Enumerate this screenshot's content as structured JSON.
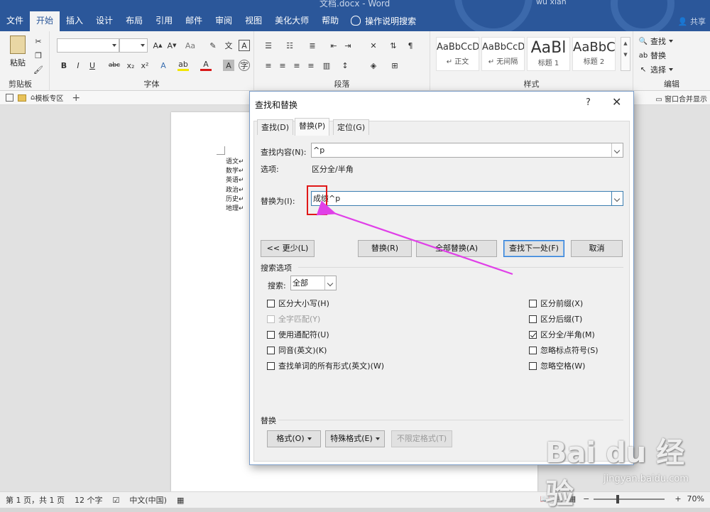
{
  "window": {
    "title": "文档.docx  -  Word",
    "user": "wu xian",
    "share": "共享"
  },
  "menu": {
    "items": [
      "文件",
      "开始",
      "插入",
      "设计",
      "布局",
      "引用",
      "邮件",
      "审阅",
      "视图",
      "美化大师",
      "帮助"
    ],
    "active_index": 1,
    "tell_me": "操作说明搜索"
  },
  "ribbon": {
    "clipboard": {
      "paste": "粘贴",
      "label": "剪贴板"
    },
    "font": {
      "label": "字体",
      "bold": "B",
      "italic": "I",
      "underline": "U",
      "strike": "abc",
      "sub": "x₂",
      "sup": "x²"
    },
    "paragraph": {
      "label": "段落"
    },
    "styles": {
      "label": "样式",
      "items": [
        {
          "sample": "AaBbCcDc",
          "name": "↵ 正文"
        },
        {
          "sample": "AaBbCcDc",
          "name": "↵ 无间隔"
        },
        {
          "sample": "AaBl",
          "name": "标题 1"
        },
        {
          "sample": "AaBbC",
          "name": "标题 2"
        }
      ]
    },
    "editing": {
      "label": "编辑",
      "find": "查找",
      "replace": "替换",
      "select": "选择"
    }
  },
  "tabbar": {
    "template_zone": "模板专区",
    "merge": "窗口合并显示"
  },
  "document": {
    "lines": [
      "语文↵",
      "数学↵",
      "英语↵",
      "政治↵",
      "历史↵",
      "地理↵"
    ]
  },
  "dialog": {
    "title": "查找和替换",
    "help": "?",
    "tabs": [
      "查找(D)",
      "替换(P)",
      "定位(G)"
    ],
    "active_tab": 1,
    "find_label": "查找内容(N):",
    "find_value": "^p",
    "options_label": "选项:",
    "options_value": "区分全/半角",
    "replace_label": "替换为(I):",
    "replace_value": "成绩^p",
    "buttons": {
      "less": "<< 更少(L)",
      "replace": "替换(R)",
      "replace_all": "全部替换(A)",
      "find_next": "查找下一处(F)",
      "cancel": "取消"
    },
    "search_options_title": "搜索选项",
    "search_label": "搜索:",
    "search_value": "全部",
    "left_checks": [
      {
        "label": "区分大小写(H)",
        "checked": false,
        "disabled": false
      },
      {
        "label": "全字匹配(Y)",
        "checked": false,
        "disabled": true
      },
      {
        "label": "使用通配符(U)",
        "checked": false,
        "disabled": false
      },
      {
        "label": "同音(英文)(K)",
        "checked": false,
        "disabled": false
      },
      {
        "label": "查找单词的所有形式(英文)(W)",
        "checked": false,
        "disabled": false
      }
    ],
    "right_checks": [
      {
        "label": "区分前缀(X)",
        "checked": false
      },
      {
        "label": "区分后缀(T)",
        "checked": false
      },
      {
        "label": "区分全/半角(M)",
        "checked": true
      },
      {
        "label": "忽略标点符号(S)",
        "checked": false
      },
      {
        "label": "忽略空格(W)",
        "checked": false
      }
    ],
    "replace_section_title": "替换",
    "bottom_buttons": {
      "format": "格式(O)",
      "special": "特殊格式(E)",
      "no_format": "不限定格式(T)"
    }
  },
  "statusbar": {
    "page": "第 1 页，共 1 页",
    "words": "12 个字",
    "language": "中文(中国)",
    "zoom": "70%",
    "zoom_level_percent": 70
  },
  "watermark": {
    "main": "Bai du 经验",
    "sub": "jingyan.baidu.com"
  },
  "colors": {
    "word_blue": "#2b579a",
    "annotation_red": "#e01818",
    "annotation_magenta": "#e040e8"
  }
}
